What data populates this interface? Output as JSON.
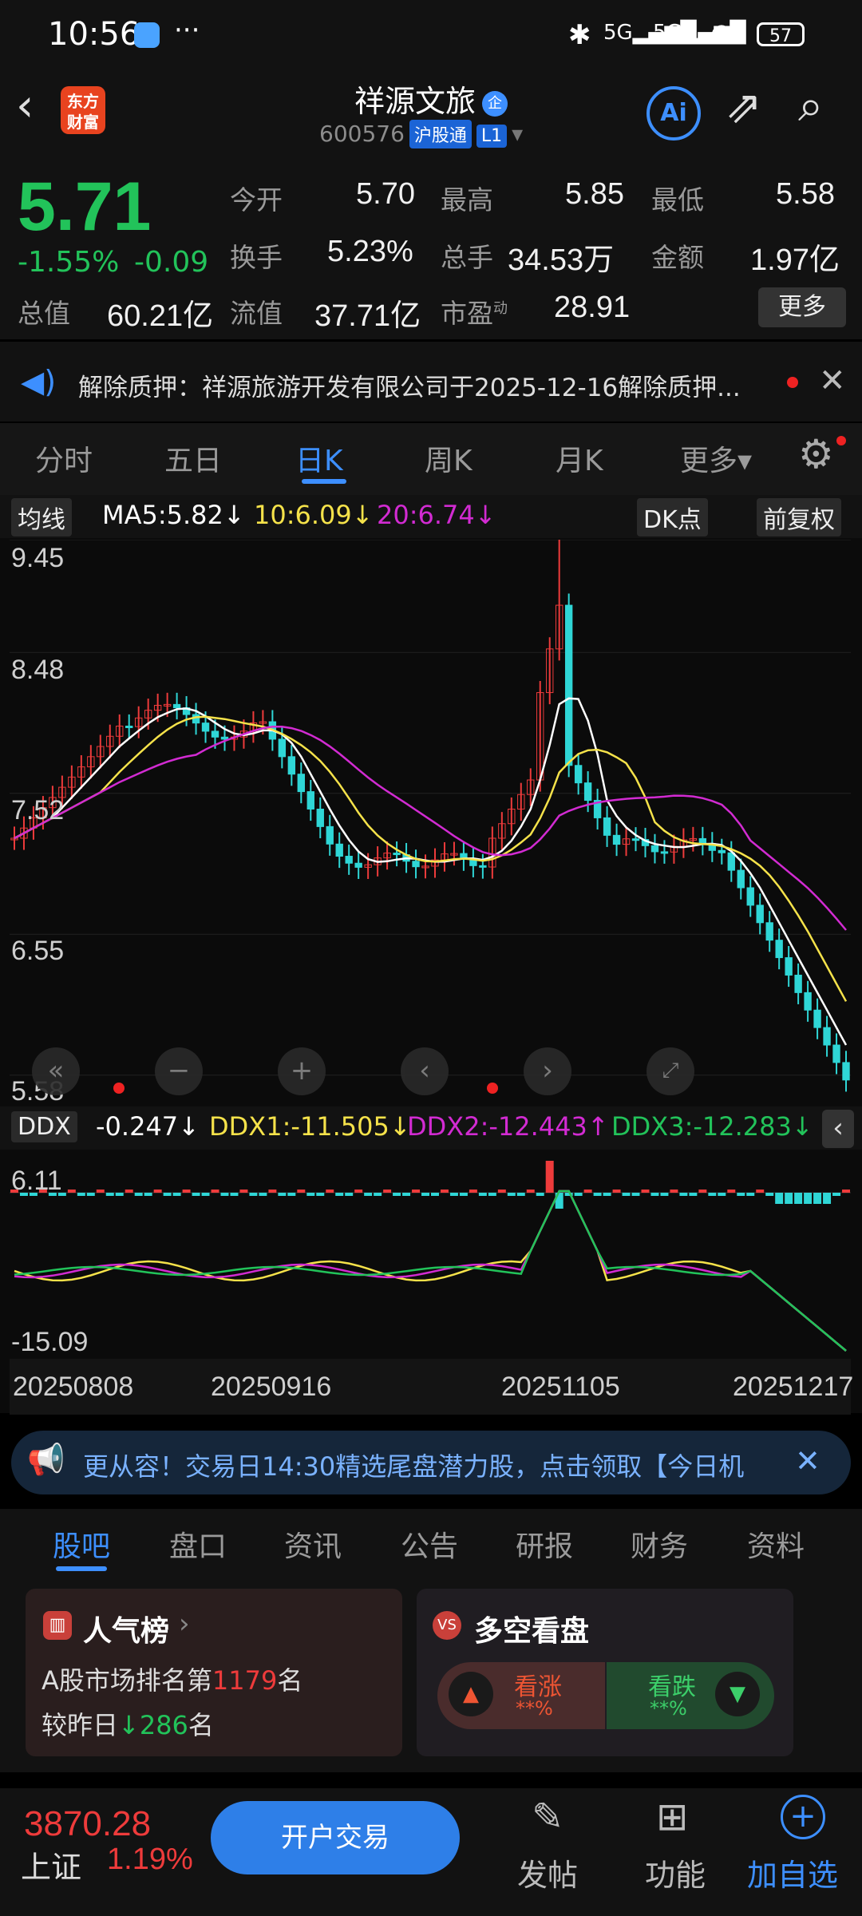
{
  "status_bar": {
    "time": "10:56",
    "battery": "57"
  },
  "header": {
    "logo": "东方财富",
    "title": "祥源文旅",
    "code": "600576",
    "badge_hkconnect": "沪股通",
    "badge_level": "L1",
    "ai_label": "Ai"
  },
  "quote": {
    "price": "5.71",
    "change_pct": "-1.55%",
    "change": "-0.09",
    "open_label": "今开",
    "open": "5.70",
    "high_label": "最高",
    "high": "5.85",
    "low_label": "最低",
    "low": "5.58",
    "turnover_label": "换手",
    "turnover": "5.23%",
    "volume_label": "总手",
    "volume": "34.53万",
    "amount_label": "金额",
    "amount": "1.97亿",
    "mktcap_label": "总值",
    "mktcap": "60.21亿",
    "float_label": "流值",
    "float": "37.71亿",
    "pe_label": "市盈",
    "pe_sup": "动",
    "pe": "28.91",
    "more_label": "更多"
  },
  "notice": {
    "text": "解除质押：祥源旅游开发有限公司于2025-12-16解除质押..."
  },
  "tabs": [
    "分时",
    "五日",
    "日K",
    "周K",
    "月K",
    "更多▾"
  ],
  "ma_bar": {
    "selector": "均线",
    "ma5": "MA5:5.82↓",
    "ma10": "10:6.09↓",
    "ma20": "20:6.74↓",
    "dk": "DK点",
    "adjust": "前复权"
  },
  "kline_axis": {
    "y1": "9.45",
    "y2": "8.48",
    "y3": "7.52",
    "y4": "6.55",
    "y5": "5.58"
  },
  "ddx_bar": {
    "selector": "DDX",
    "ddx": "-0.247↓",
    "ddx1": "DDX1:-11.505↓",
    "ddx2": "DDX2:-12.443↑",
    "ddx3": "DDX3:-12.283↓"
  },
  "ddx_axis": {
    "top": "6.11",
    "bottom": "-15.09"
  },
  "dates": [
    "20250808",
    "20250916",
    "20251105",
    "20251217"
  ],
  "promo": {
    "text": "更从容！交易日14:30精选尾盘潜力股，点击领取【今日机"
  },
  "bottom_tabs": [
    "股吧",
    "盘口",
    "资讯",
    "公告",
    "研报",
    "财务",
    "资料"
  ],
  "popularity": {
    "title": "人气榜",
    "rank_prefix": "A股市场排名第",
    "rank": "1179",
    "rank_suffix": "名",
    "change_prefix": "较昨日",
    "change": "286",
    "change_suffix": "名"
  },
  "sentiment": {
    "title": "多空看盘",
    "up_label": "看涨",
    "up_val": "**%",
    "down_label": "看跌",
    "down_val": "**%"
  },
  "footer": {
    "index_value": "3870.28",
    "index_name": "上证",
    "index_change": "1.19%",
    "trade_btn": "开户交易",
    "post": "发帖",
    "func": "功能",
    "watch": "加自选"
  },
  "colors": {
    "up": "#ee3b3b",
    "down": "#22c35a",
    "accent": "#3d8fff",
    "ma5": "#ffffff",
    "ma10": "#f5e24a",
    "ma20": "#d22bd2"
  }
}
